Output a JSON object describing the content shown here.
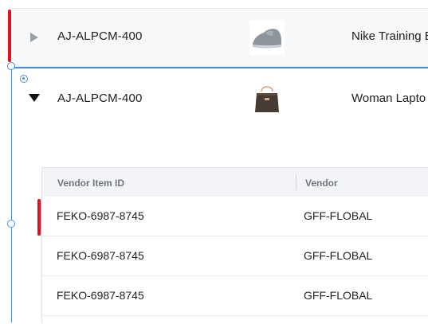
{
  "rows": [
    {
      "sku": "AJ-ALPCM-400",
      "product": "Nike Training E",
      "thumb": "gray-sneaker",
      "expanded": false
    },
    {
      "sku": "AJ-ALPCM-400",
      "product": "Woman Lapto",
      "thumb": "brown-handbag",
      "expanded": true
    }
  ],
  "subtable": {
    "headers": [
      "Vendor Item ID",
      "Vendor"
    ],
    "rows": [
      {
        "vendor_item_id": "FEKO-6987-8745",
        "vendor": "GFF-FLOBAL"
      },
      {
        "vendor_item_id": "FEKO-6987-8745",
        "vendor": "GFF-FLOBAL"
      },
      {
        "vendor_item_id": "FEKO-6987-8745",
        "vendor": "GFF-FLOBAL"
      }
    ]
  },
  "colors": {
    "selection": "#4a90d9",
    "annotation": "#e0121b",
    "header_bg": "#f2f4f7",
    "row_bg": "#f7f8f9"
  }
}
